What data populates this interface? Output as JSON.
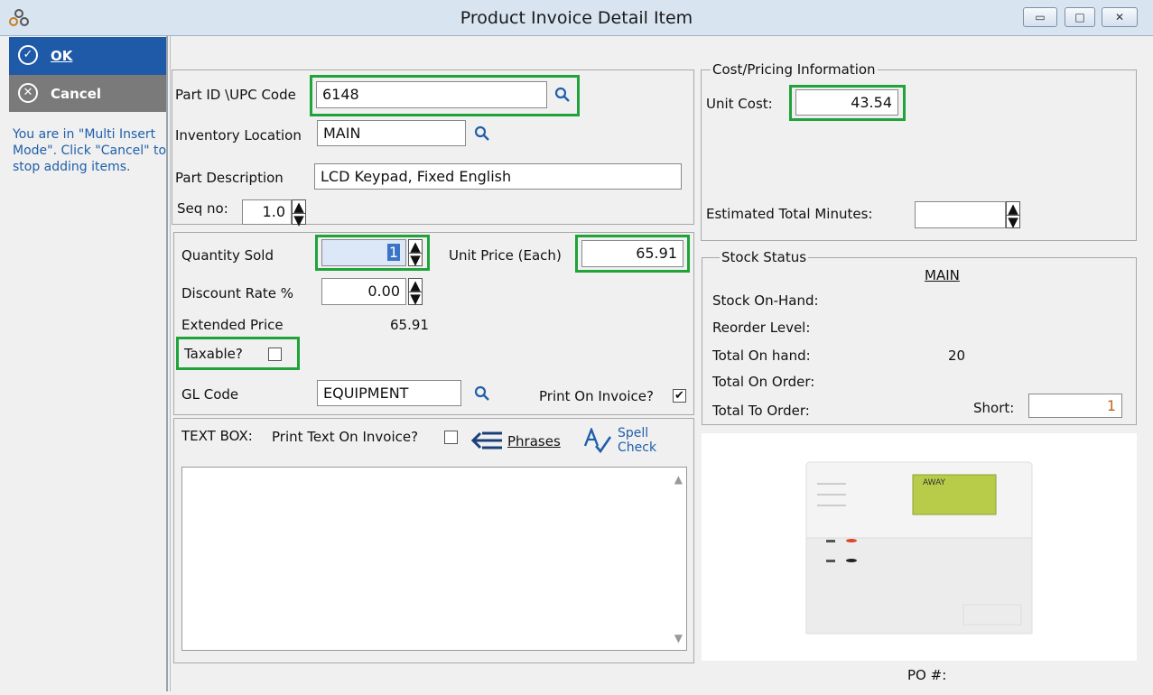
{
  "window": {
    "title": "Product Invoice Detail Item"
  },
  "sidebar": {
    "ok_label": "OK",
    "cancel_label": "Cancel",
    "info": "You are in \"Multi Insert Mode\". Click \"Cancel\" to stop adding items."
  },
  "part": {
    "part_id_label": "Part ID \\UPC Code",
    "part_id_value": "6148",
    "inventory_location_label": "Inventory Location",
    "inventory_location_value": "MAIN",
    "description_label": "Part Description",
    "description_value": "LCD Keypad, Fixed English",
    "seq_label": "Seq no:",
    "seq_value": "1.0"
  },
  "pricing": {
    "quantity_label": "Quantity Sold",
    "quantity_value": "1",
    "unit_price_label": "Unit Price (Each)",
    "unit_price_value": "65.91",
    "discount_label": "Discount Rate %",
    "discount_value": "0.00",
    "extended_label": "Extended Price",
    "extended_value": "65.91",
    "taxable_label": "Taxable?",
    "gl_label": "GL Code",
    "gl_value": "EQUIPMENT",
    "print_on_invoice_label": "Print On Invoice?"
  },
  "textbox": {
    "label": "TEXT BOX:",
    "print_text_label": "Print Text On Invoice?",
    "phrases_label": "Phrases",
    "spell_label_1": "Spell",
    "spell_label_2": "Check"
  },
  "cost": {
    "legend": "Cost/Pricing Information",
    "unit_cost_label": "Unit Cost:",
    "unit_cost_value": "43.54",
    "est_minutes_label": "Estimated Total Minutes:"
  },
  "stock": {
    "legend": "Stock Status",
    "location": "MAIN",
    "on_hand_label": "Stock On-Hand:",
    "reorder_label": "Reorder Level:",
    "total_on_hand_label": "Total On hand:",
    "total_on_hand_value": "20",
    "total_on_order_label": "Total On Order:",
    "total_to_order_label": "Total To Order:",
    "short_label": "Short:",
    "short_value": "1"
  },
  "image": {
    "lcd_text": "AWAY"
  },
  "footer": {
    "po_label": "PO #:"
  }
}
